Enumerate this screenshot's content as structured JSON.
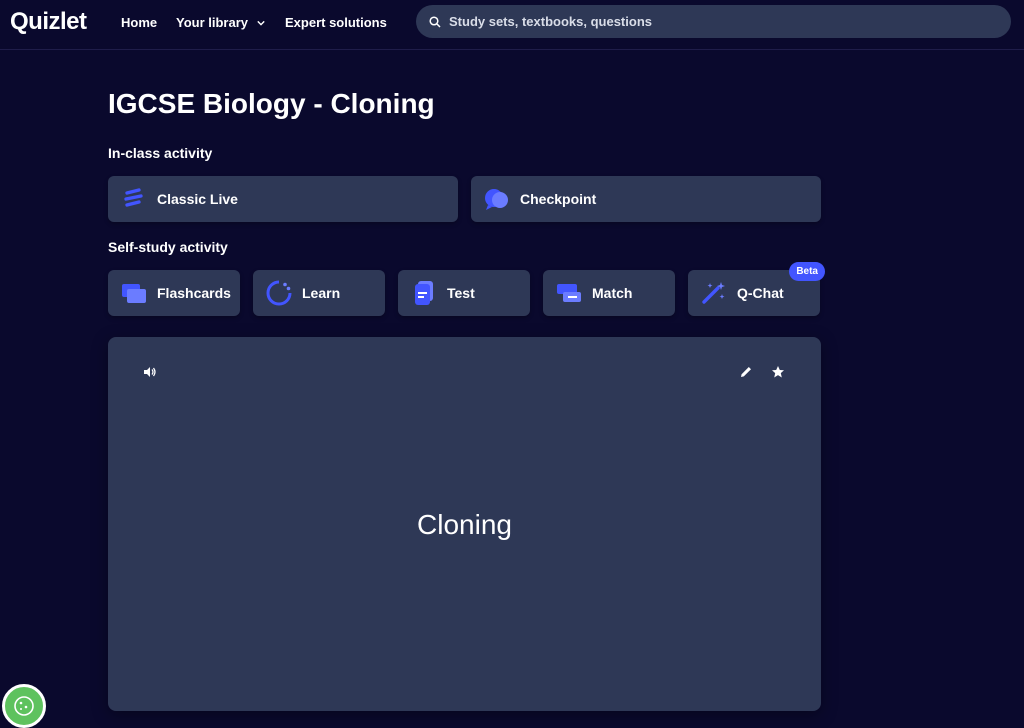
{
  "header": {
    "logo": "Quizlet",
    "nav": {
      "home": "Home",
      "library": "Your library",
      "expert": "Expert solutions"
    },
    "search": {
      "placeholder": "Study sets, textbooks, questions"
    }
  },
  "set": {
    "title": "IGCSE Biology - Cloning"
  },
  "in_class": {
    "heading": "In-class activity",
    "items": [
      {
        "label": "Classic Live",
        "icon": "classic-live-icon"
      },
      {
        "label": "Checkpoint",
        "icon": "checkpoint-icon"
      }
    ]
  },
  "self_study": {
    "heading": "Self-study activity",
    "items": [
      {
        "label": "Flashcards",
        "icon": "flashcards-icon"
      },
      {
        "label": "Learn",
        "icon": "learn-icon"
      },
      {
        "label": "Test",
        "icon": "test-icon"
      },
      {
        "label": "Match",
        "icon": "match-icon"
      },
      {
        "label": "Q-Chat",
        "icon": "magic-wand-icon",
        "badge": "Beta"
      }
    ]
  },
  "flashcard": {
    "term": "Cloning",
    "icons": [
      "audio-icon",
      "edit-icon",
      "star-icon"
    ]
  },
  "colors": {
    "background": "#0a092d",
    "card": "#2e3856",
    "accent": "#4255ff",
    "cookie": "#5ec25e"
  }
}
